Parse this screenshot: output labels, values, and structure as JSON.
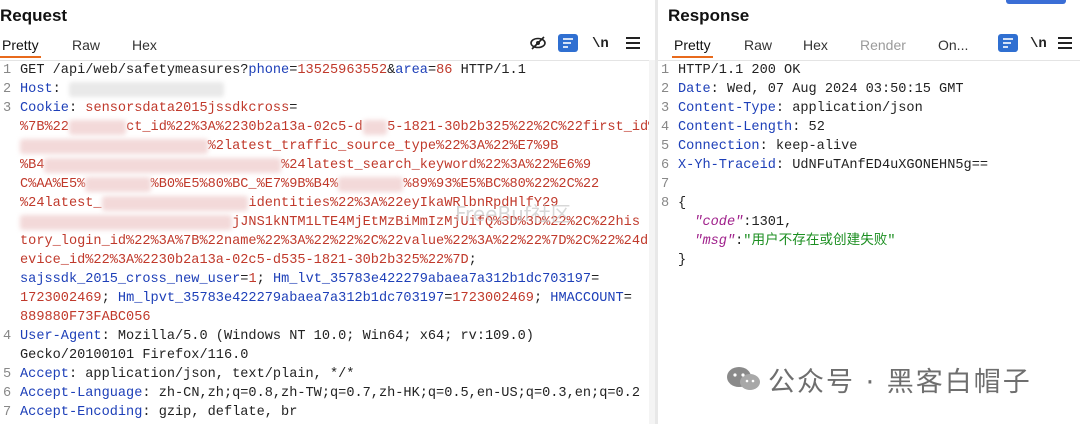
{
  "request": {
    "title": "Request",
    "tabs": [
      "Pretty",
      "Raw",
      "Hex"
    ],
    "tools": {
      "newline": "\\n"
    },
    "lines": [
      {
        "n": "1",
        "parts": [
          [
            "GET /api/web/safetymeasures?",
            ""
          ],
          [
            "phone",
            "k"
          ],
          [
            "=",
            ""
          ],
          [
            "13525963552",
            "v"
          ],
          [
            "&",
            ""
          ],
          [
            "area",
            "k"
          ],
          [
            "=",
            ""
          ],
          [
            "86",
            "v"
          ],
          [
            " HTTP/1.1",
            ""
          ]
        ]
      },
      {
        "n": "2",
        "parts": [
          [
            "Host",
            "k"
          ],
          [
            ": ",
            ""
          ],
          [
            "xxxxxxxxxxxxxxxxxxx",
            "blur"
          ]
        ]
      },
      {
        "n": "3",
        "parts": [
          [
            "Cookie",
            "k"
          ],
          [
            ": ",
            ""
          ],
          [
            "sensorsdata2015jssdkcross",
            "v"
          ],
          [
            "=",
            ""
          ]
        ]
      },
      {
        "n": "",
        "parts": [
          [
            "%7B%22",
            "v"
          ],
          [
            "xxxxxxx",
            "blur-red"
          ],
          [
            "ct_id%22%3A%2230b2a13a-02c5-d",
            "v"
          ],
          [
            "xxx",
            "blur-red"
          ],
          [
            "5-1821-30b2b325%22%2C%22first_id%2",
            "v"
          ]
        ]
      },
      {
        "n": "",
        "parts": [
          [
            "xxxxxxxxxxxxxxxxxxxxxxx",
            "blur-red"
          ],
          [
            "%2latest_traffic_source_type%22%3A%22%E7%9B",
            "v"
          ]
        ]
      },
      {
        "n": "",
        "parts": [
          [
            "%B4",
            "v"
          ],
          [
            "xxxxxxxxxxxxxxxxxxxxxxxxxxxxx",
            "blur-red"
          ],
          [
            "%24latest_search_keyword%22%3A%22%E6%9",
            "v"
          ]
        ]
      },
      {
        "n": "",
        "parts": [
          [
            "C%AA%E5%",
            "v"
          ],
          [
            "xxxxxxxx",
            "blur-red"
          ],
          [
            "%B0%E5%80%BC_%E7%9B%B4%",
            "v"
          ],
          [
            "xxxxxxxx",
            "blur-red"
          ],
          [
            "%89%93%E5%BC%80%22%2C%22",
            "v"
          ]
        ]
      },
      {
        "n": "",
        "parts": [
          [
            "%24latest_",
            "v"
          ],
          [
            "xxxxxxxxxxxxxxxxxx",
            "blur-red"
          ],
          [
            "identities%22%3A%22eyIkaWRlbnRpdHlfY29",
            "v"
          ]
        ]
      },
      {
        "n": "",
        "parts": [
          [
            "xxxxxxxxxxxxxxxxxxxxxxxxxx",
            "blur-red"
          ],
          [
            "jJNS1kNTM1LTE4MjEtMzBiMmIzMjUifQ%3D%3D%22%2C%22his",
            "v"
          ]
        ]
      },
      {
        "n": "",
        "parts": [
          [
            "tory_login_id%22%3A%7B%22name%22%3A%22%22%2C%22value%22%3A%22%22%7D%2C%22%24d",
            "v"
          ]
        ]
      },
      {
        "n": "",
        "parts": [
          [
            "evice_id%22%3A%2230b2a13a-02c5-d535-1821-30b2b325%22%7D",
            "v"
          ],
          [
            ";",
            ""
          ]
        ]
      },
      {
        "n": "",
        "parts": [
          [
            "sajssdk_2015_cross_new_user",
            "k"
          ],
          [
            "=",
            ""
          ],
          [
            "1",
            "v"
          ],
          [
            "; ",
            ""
          ],
          [
            "Hm_lvt_35783e422279abaea7a312b1dc703197",
            "k"
          ],
          [
            "=",
            ""
          ]
        ]
      },
      {
        "n": "",
        "parts": [
          [
            "1723002469",
            "v"
          ],
          [
            "; ",
            ""
          ],
          [
            "Hm_lpvt_35783e422279abaea7a312b1dc703197",
            "k"
          ],
          [
            "=",
            ""
          ],
          [
            "1723002469",
            "v"
          ],
          [
            "; ",
            ""
          ],
          [
            "HMACCOUNT",
            "k"
          ],
          [
            "=",
            ""
          ]
        ]
      },
      {
        "n": "",
        "parts": [
          [
            "889880F73FABC056",
            "v"
          ]
        ]
      },
      {
        "n": "4",
        "parts": [
          [
            "User-Agent",
            "k"
          ],
          [
            ": Mozilla/5.0 (Windows NT 10.0; Win64; x64; rv:109.0)",
            ""
          ]
        ]
      },
      {
        "n": "",
        "parts": [
          [
            "Gecko/20100101 Firefox/116.0",
            ""
          ]
        ]
      },
      {
        "n": "5",
        "parts": [
          [
            "Accept",
            "k"
          ],
          [
            ": application/json, text/plain, */*",
            ""
          ]
        ]
      },
      {
        "n": "6",
        "parts": [
          [
            "Accept-Language",
            "k"
          ],
          [
            ": zh-CN,zh;q=0.8,zh-TW;q=0.7,zh-HK;q=0.5,en-US;q=0.3,en;q=0.2",
            ""
          ]
        ]
      },
      {
        "n": "7",
        "parts": [
          [
            "Accept-Encoding",
            "k"
          ],
          [
            ": gzip, deflate, br",
            ""
          ]
        ]
      }
    ]
  },
  "response": {
    "title": "Response",
    "tabs": [
      "Pretty",
      "Raw",
      "Hex",
      "Render",
      "On..."
    ],
    "tools": {
      "newline": "\\n"
    },
    "lines": [
      {
        "n": "1",
        "parts": [
          [
            "HTTP/1.1 200 OK",
            ""
          ]
        ]
      },
      {
        "n": "2",
        "parts": [
          [
            "Date",
            "k"
          ],
          [
            ": Wed, 07 Aug 2024 03:50:15 GMT",
            ""
          ]
        ]
      },
      {
        "n": "3",
        "parts": [
          [
            "Content-Type",
            "k"
          ],
          [
            ": application/json",
            ""
          ]
        ]
      },
      {
        "n": "4",
        "parts": [
          [
            "Content-Length",
            "k"
          ],
          [
            ": 52",
            ""
          ]
        ]
      },
      {
        "n": "5",
        "parts": [
          [
            "Connection",
            "k"
          ],
          [
            ": keep-alive",
            ""
          ]
        ]
      },
      {
        "n": "6",
        "parts": [
          [
            "X-Yh-Traceid",
            "k"
          ],
          [
            ": UdNFuTAnfED4uXGONEHN5g==",
            ""
          ]
        ]
      },
      {
        "n": "7",
        "parts": [
          [
            "",
            ""
          ]
        ]
      },
      {
        "n": "8",
        "parts": [
          [
            "{",
            ""
          ]
        ]
      },
      {
        "n": "",
        "parts": [
          [
            "  ",
            ""
          ],
          [
            "\"code\"",
            "jk"
          ],
          [
            ":1301,",
            ""
          ]
        ]
      },
      {
        "n": "",
        "parts": [
          [
            "  ",
            ""
          ],
          [
            "\"msg\"",
            "jk"
          ],
          [
            ":",
            ""
          ],
          [
            "\"用户不存在或创建失败\"",
            "jv"
          ]
        ]
      },
      {
        "n": "",
        "parts": [
          [
            "}",
            ""
          ]
        ]
      }
    ]
  },
  "watermark": {
    "text": "公众号 · 黑客白帽子",
    "faint_text": "FreeBuf社区"
  }
}
